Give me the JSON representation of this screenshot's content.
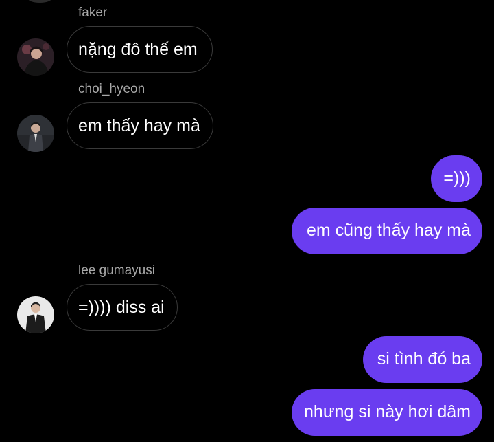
{
  "theme": {
    "background": "#000000",
    "outgoing_bubble": "#6a3df0",
    "incoming_border": "#3a3a3a",
    "sender_name_color": "#a8a8a8"
  },
  "messages": [
    {
      "direction": "incoming",
      "sender": "faker",
      "text": "nặng đô thế em",
      "avatar_icon": "user-avatar-icon"
    },
    {
      "direction": "incoming",
      "sender": "choi_hyeon",
      "text": "em thấy hay mà",
      "avatar_icon": "user-avatar-icon"
    },
    {
      "direction": "outgoing",
      "text": "=)))"
    },
    {
      "direction": "outgoing",
      "text": "em cũng thấy hay mà"
    },
    {
      "direction": "incoming",
      "sender": "lee gumayusi",
      "text": "=)))) diss ai",
      "avatar_icon": "user-avatar-icon"
    },
    {
      "direction": "outgoing",
      "text": "si tình đó ba"
    },
    {
      "direction": "outgoing",
      "text": "nhưng si này hơi dâm"
    }
  ]
}
